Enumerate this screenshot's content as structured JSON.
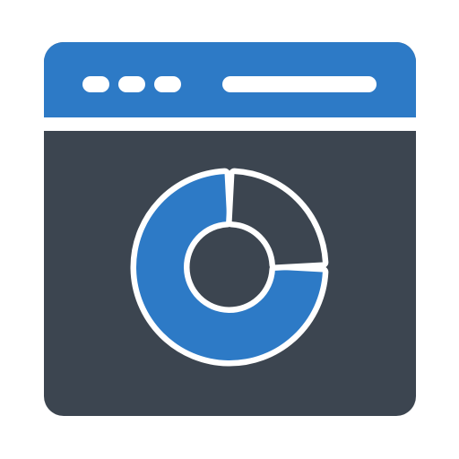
{
  "icon": {
    "name": "browser-window-donut-chart-icon",
    "colors": {
      "frame_accent": "#2D7AC6",
      "window_body": "#3C4550",
      "chart_segment_main": "#2D7AC6",
      "chart_segment_secondary": "#3C4550",
      "outline": "#FFFFFF"
    },
    "title_bar": {
      "window_controls": [
        "dot",
        "dot",
        "dot"
      ],
      "address_bar": "line"
    },
    "donut_chart": {
      "segments": [
        {
          "share": 0.75
        },
        {
          "share": 0.25
        }
      ]
    }
  }
}
